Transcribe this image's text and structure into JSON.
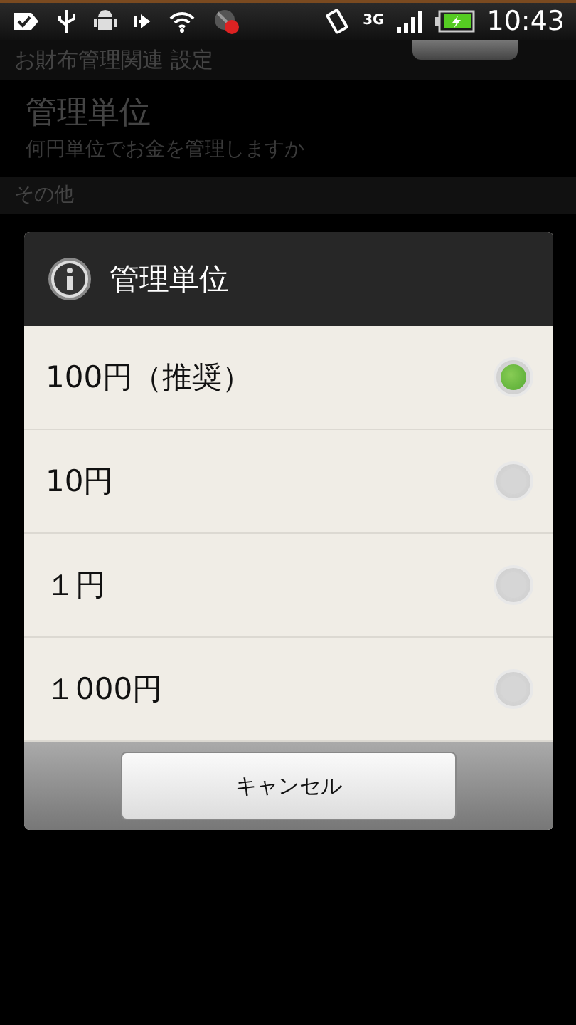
{
  "status_bar": {
    "network": "3G",
    "time": "10:43"
  },
  "header": {
    "title": "お財布管理関連 設定"
  },
  "preference": {
    "title": "管理単位",
    "summary": "何円単位でお金を管理しますか"
  },
  "category": {
    "title": "その他"
  },
  "dialog": {
    "title": "管理単位",
    "options": [
      {
        "label": "100円（推奨）",
        "selected": true
      },
      {
        "label": "10円",
        "selected": false
      },
      {
        "label": "１円",
        "selected": false
      },
      {
        "label": "１000円",
        "selected": false
      }
    ],
    "buttons": [
      "キャンセル"
    ]
  }
}
